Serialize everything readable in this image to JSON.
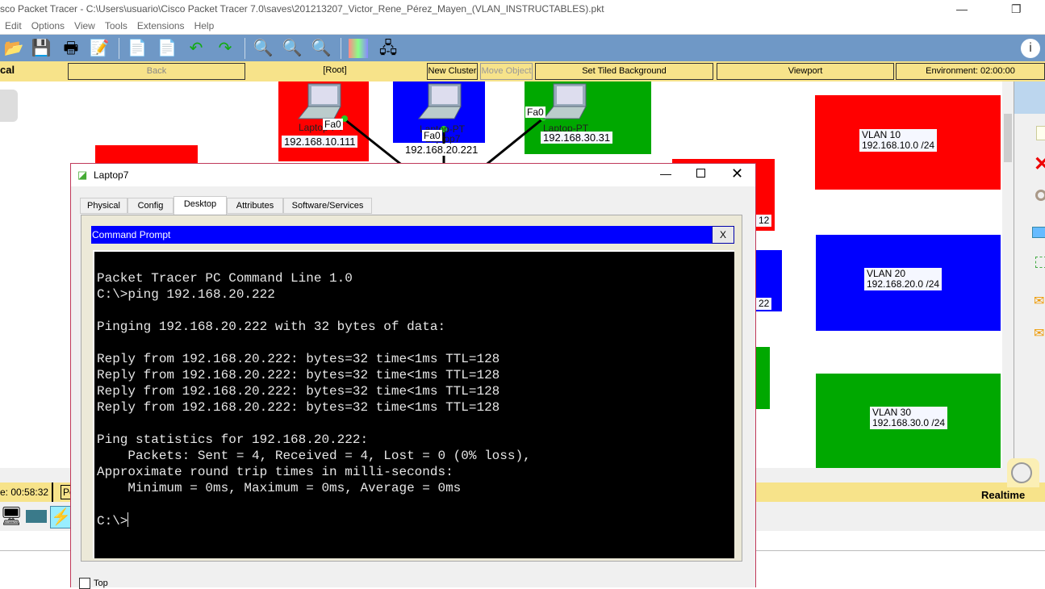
{
  "app": {
    "title": "sco Packet Tracer - C:\\Users\\usuario\\Cisco Packet Tracer 7.0\\saves\\201213207_Victor_Rene_Pérez_Mayen_(VLAN_INSTRUCTABLES).pkt"
  },
  "menu": [
    "Edit",
    "Options",
    "View",
    "Tools",
    "Extensions",
    "Help"
  ],
  "nav": {
    "logical": "cal",
    "back": "Back",
    "root": "[Root]",
    "new_cluster": "New Cluster",
    "move_object": "Move Object",
    "tiled_bg": "Set Tiled Background",
    "viewport": "Viewport",
    "environment": "Environment: 02:00:00"
  },
  "canvas": {
    "devices": [
      {
        "name": "Laptop-PT",
        "port": "Fa0",
        "ip": "192.168.10.111"
      },
      {
        "name": "Laptop-PT",
        "name2": "Laptop7",
        "port": "Fa0",
        "ip": "192.168.20.221"
      },
      {
        "name": "Laptop-PT",
        "port": "Fa0",
        "ip": "192.168.30.31"
      }
    ],
    "partial_labels": [
      "12",
      "22"
    ],
    "vlans": [
      {
        "name": "VLAN 10",
        "net": "192.168.10.0 /24",
        "color": "#ff0000"
      },
      {
        "name": "VLAN 20",
        "net": "192.168.20.0 /24",
        "color": "#0000ff"
      },
      {
        "name": "VLAN 30",
        "net": "192.168.30.0 /24",
        "color": "#00a800"
      }
    ]
  },
  "bottom": {
    "time": "e: 00:58:32",
    "mode_partial": "Po",
    "realtime": "Realtime"
  },
  "window": {
    "title": "Laptop7",
    "tabs": [
      "Physical",
      "Config",
      "Desktop",
      "Attributes",
      "Software/Services"
    ],
    "active_tab": "Desktop",
    "cmd_title": "Command Prompt",
    "cmd_close": "X",
    "terminal": "Packet Tracer PC Command Line 1.0\nC:\\>ping 192.168.20.222\n\nPinging 192.168.20.222 with 32 bytes of data:\n\nReply from 192.168.20.222: bytes=32 time<1ms TTL=128\nReply from 192.168.20.222: bytes=32 time<1ms TTL=128\nReply from 192.168.20.222: bytes=32 time<1ms TTL=128\nReply from 192.168.20.222: bytes=32 time<1ms TTL=128\n\nPing statistics for 192.168.20.222:\n    Packets: Sent = 4, Received = 4, Lost = 0 (0% loss),\nApproximate round trip times in milli-seconds:\n    Minimum = 0ms, Maximum = 0ms, Average = 0ms\n\nC:\\>",
    "top_label": "Top"
  }
}
